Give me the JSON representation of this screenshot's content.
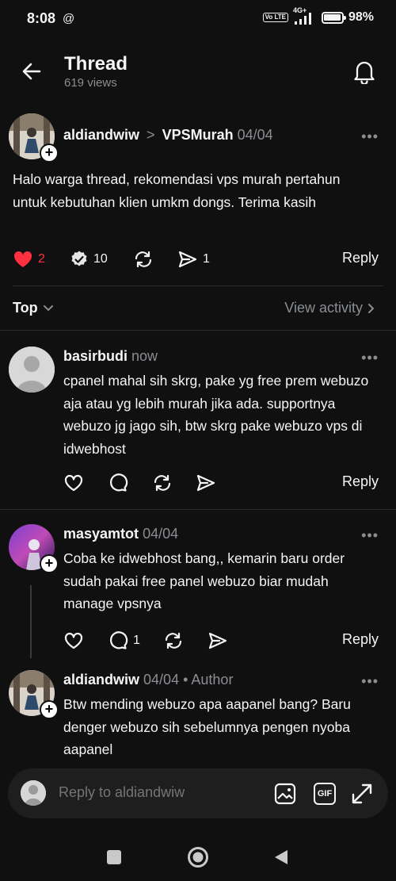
{
  "status_bar": {
    "time": "8:08",
    "threads_glyph": "@",
    "volte": "Vo LTE",
    "network": "4G+",
    "battery": "98%",
    "battery_level": 0.98
  },
  "header": {
    "title": "Thread",
    "views": "619 views"
  },
  "main_post": {
    "author": "aldiandwiw",
    "chevron": ">",
    "community": "VPSMurah",
    "date": "04/04",
    "more": "•••",
    "text": "Halo warga thread, rekomendasi vps murah pertahun untuk kebutuhan klien umkm dongs. Terima kasih",
    "likes": "2",
    "replies": "10",
    "shares": "1",
    "reply_label": "Reply"
  },
  "sort": {
    "label": "Top",
    "view_activity": "View activity"
  },
  "comments": [
    {
      "author": "basirbudi",
      "time": "now",
      "more": "•••",
      "text": "cpanel mahal sih skrg, pake yg free prem webuzo aja atau yg lebih murah jika ada. supportnya webuzo jg jago sih, btw skrg pake webuzo vps di idwebhost",
      "reply_label": "Reply"
    },
    {
      "author": "masyamtot",
      "time": "04/04",
      "more": "•••",
      "text": "Coba ke idwebhost bang,, kemarin baru order sudah pakai free panel webuzo biar mudah manage vpsnya",
      "reply_count": "1",
      "reply_label": "Reply"
    },
    {
      "author": "aldiandwiw",
      "time": "04/04",
      "author_tag": "• Author",
      "more": "•••",
      "text": "Btw mending webuzo apa aapanel bang? Baru denger webuzo sih sebelumnya pengen nyoba aapanel"
    }
  ],
  "composer": {
    "placeholder": "Reply to aldiandwiw",
    "gif_label": "GIF"
  },
  "colors": {
    "background": "#101010",
    "text": "#f3f5f7",
    "muted": "#8a8d91",
    "like_red": "#ff3040",
    "composer_bg": "#1e1e1e"
  }
}
